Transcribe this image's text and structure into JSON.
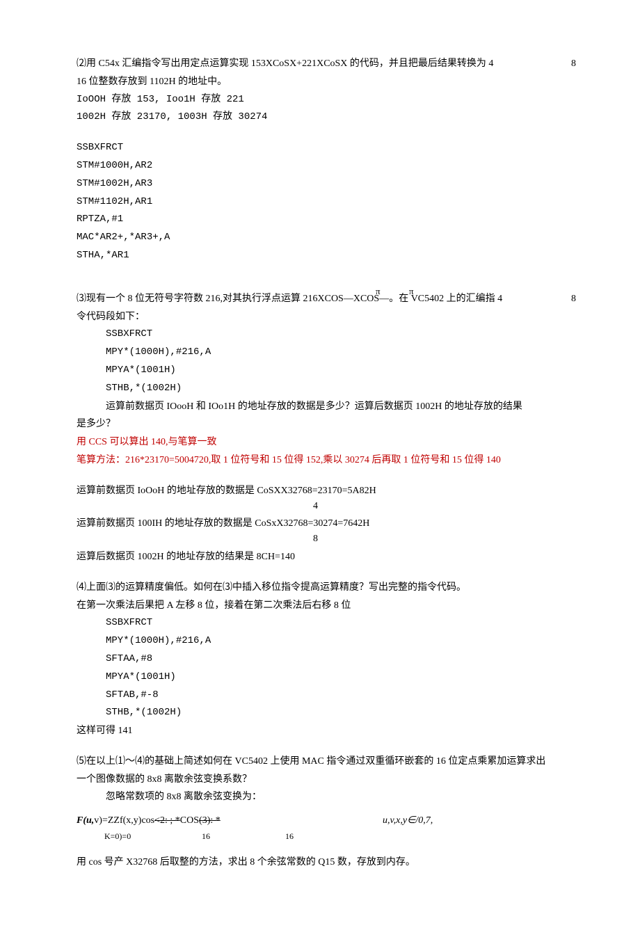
{
  "q2": {
    "prompt_a": "⑵用 C54x 汇编指令写出用定点运算实现 153XCoSX+221XCoSX 的代码，并且把最后结果转换为 4",
    "prompt_a_right": "8",
    "prompt_b": "16 位整数存放到 1102H 的地址中。",
    "line1": "IoOOH 存放 153, Ioo1H 存放 221",
    "line2": "1002H 存放 23170, 1003H 存放 30274",
    "code": [
      "SSBXFRCT",
      "STM#1000H,AR2",
      "STM#1002H,AR3",
      "STM#1102H,AR1",
      "RPTZA,#1",
      "MAC*AR2+,*AR3+,A",
      "STHA,*AR1"
    ]
  },
  "q3": {
    "prompt_a": "⑶现有一个 8 位无符号字符数 216,对其执行浮点运算 216XCOS—XCOS—。在 VC5402 上的汇编指 4",
    "prompt_a_right": "8",
    "pi1": "π",
    "pi2": "π",
    "prompt_b": "令代码段如下：",
    "code": [
      "SSBXFRCT",
      "MPY*(1000H),#216,A",
      "MPYA*(1001H)",
      "STHB,*(1002H)"
    ],
    "ask": "运算前数据页 IOooH 和 IOo1H 的地址存放的数据是多少？运算后数据页 1002H 的地址存放的结果",
    "ask2": "是多少？",
    "red1": "用 CCS 可以算出 140,与笔算一致",
    "red2": "笔算方法：216*23170=5004720,取 1 位符号和 15 位得 152,乘以 30274 后再取 1 位符号和 15 位得 140",
    "ans1": "运算前数据页 IoOoH 的地址存放的数据是 CoSXX32768=23170=5A82H",
    "ans1_sub": "4",
    "ans2": "运算前数据页 100IH 的地址存放的数据是 CoSxX32768=30274=7642H",
    "ans2_sub": "8",
    "ans3": "运算后数据页 1002H 的地址存放的结果是 8CH=140"
  },
  "q4": {
    "prompt": "⑷上面⑶的运算精度偏低。如何在⑶中插入移位指令提高运算精度？写出完整的指令代码。",
    "line": "在第一次乘法后果把 A 左移 8 位，接着在第二次乘法后右移 8 位",
    "code": [
      "SSBXFRCT",
      "MPY*(1000H),#216,A",
      "SFTAA,#8",
      "MPYA*(1001H)",
      "SFTAB,#-8",
      "STHB,*(1002H)"
    ],
    "result": "这样可得 141"
  },
  "q5": {
    "prompt_a": "⑸在以上⑴〜⑷的基础上简述如何在 VC5402 上使用 MAC 指令通过双重循环嵌套的 16 位定点乘累加运算求出",
    "prompt_b": "一个图像数据的 8x8 离散余弦变换系数？",
    "line": "忽略常数项的 8x8 离散余弦变换为：",
    "formula_left": "F(u,",
    "formula_v": "v)=ZZf(x,y)cos",
    "formula_mid1": "<2:  ;  *",
    "formula_cos": "COS",
    "formula_mid2": "(3):  *",
    "formula_right": "u,v,x,y∈/0,7,",
    "formula_sub_left": "K=0)=0",
    "formula_sub_16a": "16",
    "formula_sub_16b": "16",
    "final": "用 cos 号产 X32768 后取整的方法，求出 8 个余弦常数的 Q15 数，存放到内存。"
  }
}
